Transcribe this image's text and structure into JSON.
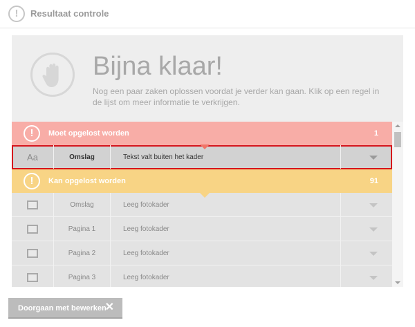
{
  "header": {
    "title": "Resultaat controle",
    "icon": "warning-icon"
  },
  "hero": {
    "title": "Bijna klaar!",
    "subtitle": "Nog een paar zaken oplossen voordat je verder kan gaan. Klik op een regel in de lijst om meer informatie te verkrijgen.",
    "icon": "hand-stop-icon"
  },
  "sections": {
    "must": {
      "label": "Moet opgelost worden",
      "count": "1",
      "color": "#f8ada7"
    },
    "can": {
      "label": "Kan opgelost worden",
      "count": "91",
      "color": "#f8d485"
    }
  },
  "must_rows": [
    {
      "icon": "Aa",
      "page": "Omslag",
      "issue": "Tekst valt buiten het kader",
      "selected": true
    }
  ],
  "can_rows": [
    {
      "icon": "photo-frame-icon",
      "page": "Omslag",
      "issue": "Leeg fotokader"
    },
    {
      "icon": "photo-frame-icon",
      "page": "Pagina 1",
      "issue": "Leeg fotokader"
    },
    {
      "icon": "photo-frame-icon",
      "page": "Pagina 2",
      "issue": "Leeg fotokader"
    },
    {
      "icon": "photo-frame-icon",
      "page": "Pagina 3",
      "issue": "Leeg fotokader"
    }
  ],
  "footer": {
    "continue_label": "Doorgaan met bewerken",
    "close_symbol": "✕"
  },
  "colors": {
    "selected_border": "#d6141c",
    "accent_red": "#f07467"
  }
}
